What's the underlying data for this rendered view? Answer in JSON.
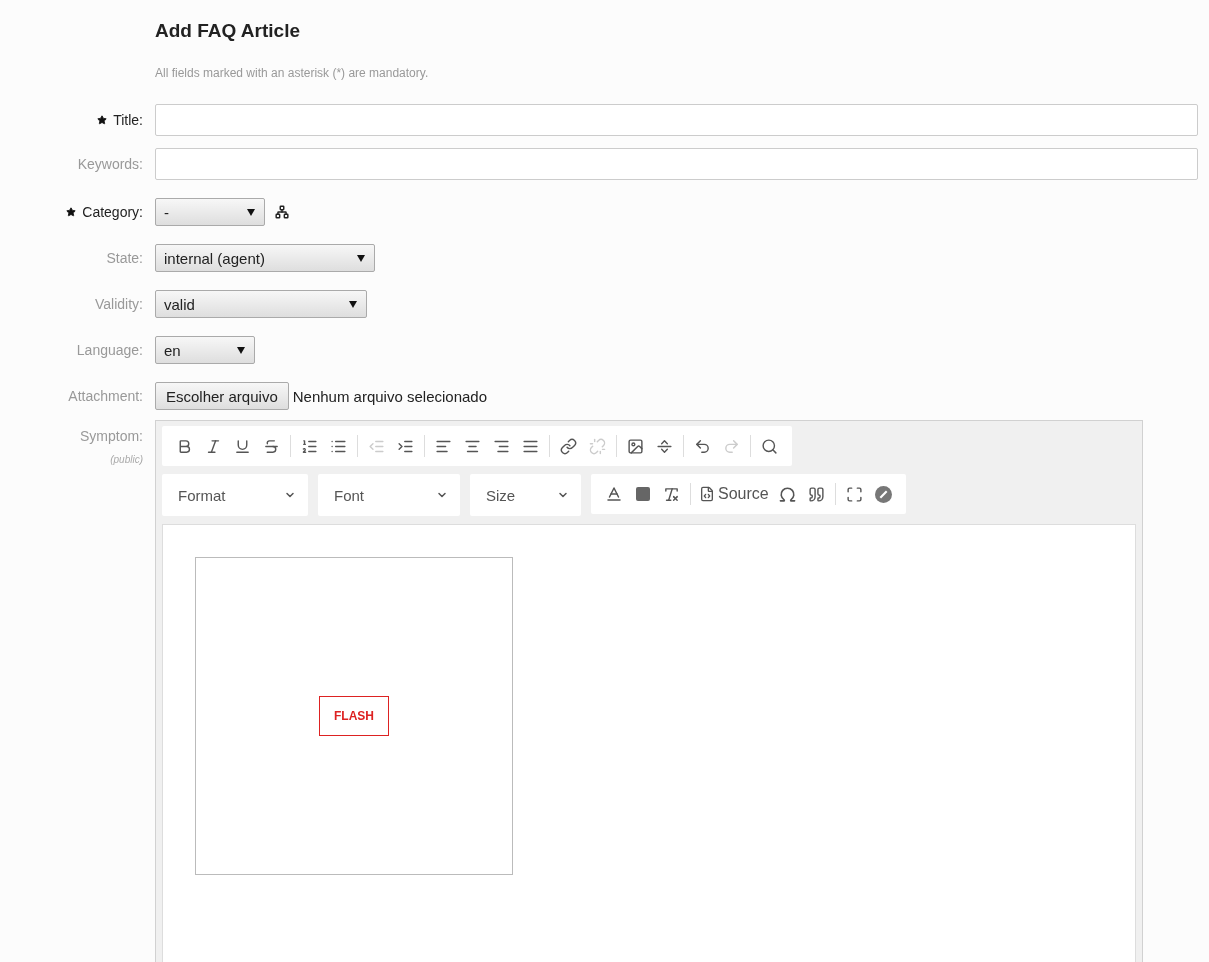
{
  "heading": "Add FAQ Article",
  "note": "All fields marked with an asterisk (*) are mandatory.",
  "fields": [
    {
      "kind": "text",
      "label": "Title:",
      "required": true
    },
    {
      "kind": "text",
      "label": "Keywords:",
      "required": false
    },
    {
      "kind": "select",
      "label": "Category:",
      "required": true,
      "value": "-",
      "tree_icon": true
    },
    {
      "kind": "select",
      "label": "State:",
      "required": false,
      "value": "internal (agent)"
    },
    {
      "kind": "select",
      "label": "Validity:",
      "required": false,
      "value": "valid"
    },
    {
      "kind": "select",
      "label": "Language:",
      "required": false,
      "value": "en"
    },
    {
      "kind": "file",
      "label": "Attachment:",
      "required": false,
      "button": "Escolher arquivo",
      "status": "Nenhum arquivo selecionado"
    }
  ],
  "editor": {
    "label": "Symptom:",
    "sublabel": "(public)",
    "toolbar_groups": [
      [
        {
          "disabled": false
        },
        {
          "disabled": false
        },
        {
          "disabled": false
        },
        {
          "disabled": false
        }
      ],
      [
        {
          "disabled": false
        },
        {
          "disabled": false
        }
      ],
      [
        {
          "disabled": true
        },
        {
          "disabled": false
        }
      ],
      [
        {
          "disabled": false
        },
        {
          "disabled": false
        },
        {
          "disabled": false
        },
        {
          "disabled": false
        }
      ],
      [
        {
          "disabled": false
        },
        {
          "disabled": true
        }
      ],
      [
        {
          "disabled": false
        },
        {
          "disabled": false
        }
      ],
      [
        {
          "disabled": false
        },
        {
          "disabled": true
        }
      ],
      [
        {
          "disabled": false
        }
      ]
    ],
    "combos": [
      "Format",
      "Font",
      "Size"
    ],
    "source_label": "Source",
    "embed": {
      "label": "FLASH"
    }
  }
}
